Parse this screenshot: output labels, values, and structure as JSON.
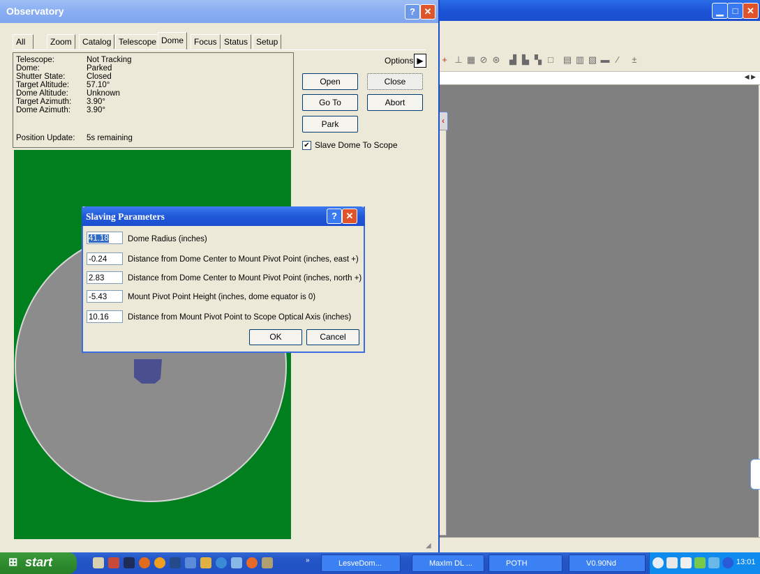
{
  "observatory": {
    "title": "Observatory",
    "tabs": [
      "All Sky",
      "Zoom",
      "Catalog",
      "Telescope",
      "Dome",
      "Focus",
      "Status",
      "Setup"
    ],
    "active_tab": "Dome",
    "status": [
      {
        "label": "Telescope:",
        "value": "Not Tracking"
      },
      {
        "label": "Dome:",
        "value": "Parked"
      },
      {
        "label": "Shutter State:",
        "value": "Closed"
      },
      {
        "label": "Target Altitude:",
        "value": "57.10°"
      },
      {
        "label": "Dome Altitude:",
        "value": "Unknown"
      },
      {
        "label": "Target Azimuth:",
        "value": "3.90°"
      },
      {
        "label": "Dome Azimuth:",
        "value": "3.90°"
      }
    ],
    "position_update": {
      "label": "Position Update:",
      "value": "5s remaining"
    },
    "options_label": "Options",
    "buttons": {
      "open": "Open",
      "close": "Close",
      "goto": "Go To",
      "abort": "Abort",
      "park": "Park"
    },
    "slave_checkbox": {
      "label": "Slave Dome To Scope",
      "checked": true
    }
  },
  "dialog": {
    "title": "Slaving Parameters",
    "params": [
      {
        "value": "41.18",
        "label": "Dome Radius (inches)"
      },
      {
        "value": "-0.24",
        "label": "Distance from Dome Center to Mount Pivot Point (inches, east +)"
      },
      {
        "value": "2.83",
        "label": "Distance from Dome Center to Mount Pivot Point (inches, north +)"
      },
      {
        "value": "-5.43",
        "label": "Mount Pivot Point Height (inches, dome equator is 0)"
      },
      {
        "value": "10.16",
        "label": "Distance from Mount Pivot Point to Scope Optical Axis (inches)"
      }
    ],
    "ok": "OK",
    "cancel": "Cancel"
  },
  "taskbar": {
    "start": "start",
    "tasks": [
      "LesveDom...",
      "MaxIm DL ...",
      "POTH",
      "V0.90Nd"
    ],
    "clock": "13:01"
  },
  "colors": {
    "title_blue": "#2158d8",
    "dome_green": "#007f1e",
    "dome_gray": "#8c8c8c",
    "taskbar_blue": "#2456c7"
  }
}
